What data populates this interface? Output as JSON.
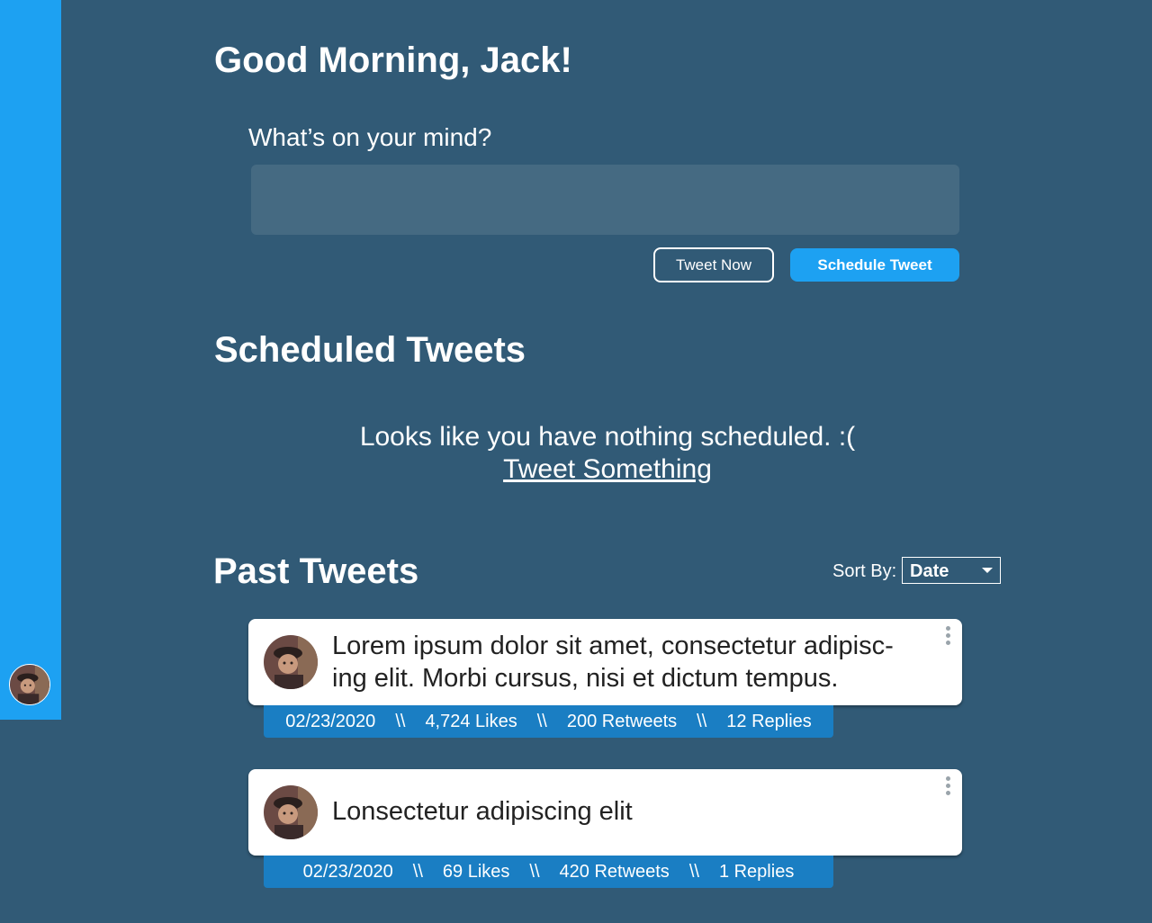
{
  "greeting": "Good Morning, Jack!",
  "compose": {
    "label": "What’s on your mind?",
    "value": "",
    "tweet_now_label": "Tweet Now",
    "schedule_label": "Schedule Tweet"
  },
  "scheduled": {
    "title": "Scheduled Tweets",
    "empty_message": "Looks like you have nothing scheduled. :(",
    "empty_link": "Tweet Something"
  },
  "past": {
    "title": "Past Tweets",
    "sort_label": "Sort By:",
    "sort_value": "Date",
    "separator": "\\\\",
    "tweets": [
      {
        "text": "Lorem ipsum dolor sit amet, consectetur adipisc-ing elit. Morbi cursus, nisi et dictum tempus.",
        "date": "02/23/2020",
        "likes": "4,724 Likes",
        "retweets": "200 Retweets",
        "replies": "12 Replies"
      },
      {
        "text": "Lonsectetur adipiscing elit",
        "date": "02/23/2020",
        "likes": "69 Likes",
        "retweets": "420 Retweets",
        "replies": "1 Replies"
      }
    ]
  },
  "icons": {
    "sidebar_avatar": "user-avatar",
    "tweet_avatar": "user-avatar",
    "menu": "more-vertical-icon",
    "sort_caret": "caret-down-icon"
  },
  "colors": {
    "background": "#315a76",
    "sidebar": "#1da1f2",
    "accent": "#1da1f2",
    "stats_bar": "#1a7ec3",
    "input": "#456a82"
  }
}
